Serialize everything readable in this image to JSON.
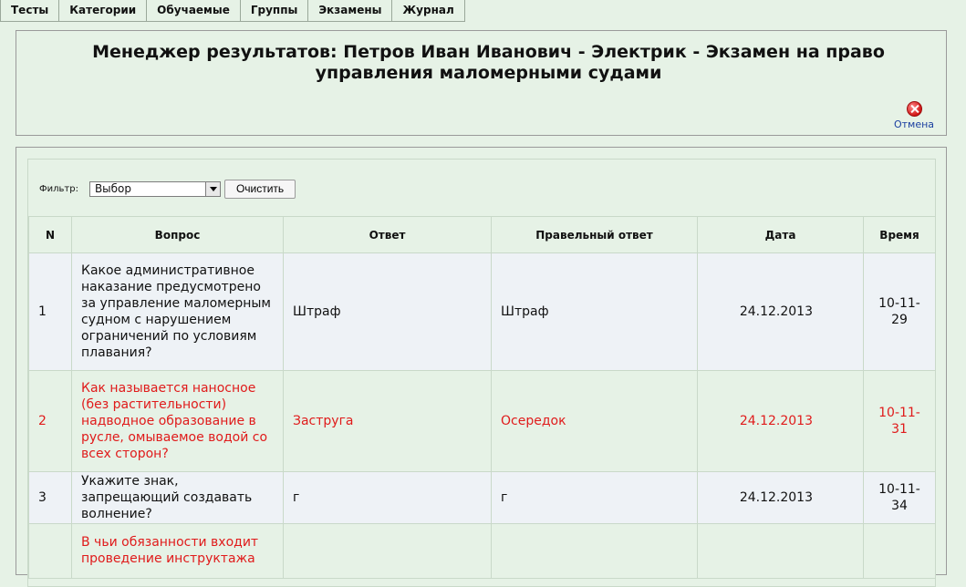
{
  "tabs": [
    "Тесты",
    "Категории",
    "Обучаемые",
    "Группы",
    "Экзамены",
    "Журнал"
  ],
  "header": {
    "title": "Менеджер результатов: Петров Иван Иванович - Электрик - Экзамен на право управления маломерными судами",
    "cancel_label": "Отмена"
  },
  "filter": {
    "label": "Фильтр:",
    "selected": "Выбор",
    "clear_label": "Очистить"
  },
  "table": {
    "columns": [
      "N",
      "Вопрос",
      "Ответ",
      "Правельный ответ",
      "Дата",
      "Время"
    ],
    "rows": [
      {
        "n": "1",
        "question": "Какое административное наказание предусмотрено за управление маломерным судном с нарушением ограничений по условиям плавания?",
        "answer": "Штраф",
        "correct": "Штраф",
        "date": "24.12.2013",
        "time": "10-11-29",
        "wrong": false
      },
      {
        "n": "2",
        "question": "Как называется наносное (без растительности) надводное образование в русле, омываемое водой со всех сторон?",
        "answer": "Заструга",
        "correct": "Осередок",
        "date": "24.12.2013",
        "time": "10-11-31",
        "wrong": true
      },
      {
        "n": "3",
        "question": "Укажите знак, запрещающий создавать волнение?",
        "answer": "г",
        "correct": "г",
        "date": "24.12.2013",
        "time": "10-11-34",
        "wrong": false
      },
      {
        "n": "",
        "question": "В чьи обязанности входит проведение инструктажа",
        "answer": "",
        "correct": "",
        "date": "",
        "time": "",
        "wrong": true
      }
    ]
  },
  "colors": {
    "background": "#e6f2e6",
    "wrong_answer": "#e01b1b",
    "link": "#1a3fa0"
  }
}
